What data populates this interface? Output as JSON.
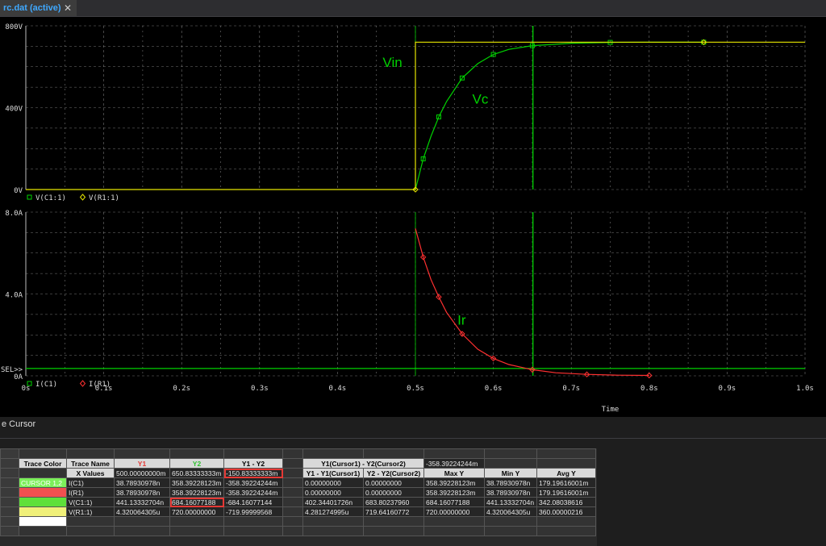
{
  "tab": {
    "title": "rc.dat (active)",
    "close": "✕"
  },
  "colors": {
    "green": "#00d200",
    "yellow": "#e6e600",
    "red": "#ff3030",
    "grid": "#9a9a9a",
    "background": "#000000"
  },
  "chart_data": [
    {
      "type": "line",
      "ylim": [
        0,
        800
      ],
      "xlim": [
        0,
        1.0
      ],
      "yticks": [
        "0V",
        "400V",
        "800V"
      ],
      "annotations": [
        "Vin",
        "Vc"
      ],
      "legend": [
        "V(C1:1)",
        "V(R1:1)"
      ],
      "series": [
        {
          "name": "V(C1:1)",
          "color": "#00d200",
          "x": [
            0.5,
            0.51,
            0.52,
            0.53,
            0.54,
            0.56,
            0.58,
            0.6,
            0.62,
            0.65,
            0.7,
            0.75,
            0.8,
            0.87
          ],
          "y": [
            0,
            150,
            260,
            355,
            430,
            545,
            615,
            660,
            685,
            703,
            715,
            719,
            720,
            720
          ]
        },
        {
          "name": "V(R1:1)",
          "color": "#e6e600",
          "x": [
            0,
            0.5,
            0.5,
            0.87,
            1.0
          ],
          "y": [
            0,
            0,
            720,
            720,
            720
          ]
        }
      ],
      "cursors_x": [
        0.5,
        0.6508
      ]
    },
    {
      "type": "line",
      "ylim": [
        0,
        8
      ],
      "xlim": [
        0,
        1.0
      ],
      "yticks": [
        "0A",
        "4.0A",
        "8.0A"
      ],
      "y_marker_label": "SEL>>",
      "xticks": [
        "0s",
        "0.1s",
        "0.2s",
        "0.3s",
        "0.4s",
        "0.5s",
        "0.6s",
        "0.7s",
        "0.8s",
        "0.9s",
        "1.0s"
      ],
      "xlabel": "Time",
      "annotations": [
        "Ir"
      ],
      "legend": [
        "I(C1)",
        "I(R1)"
      ],
      "series": [
        {
          "name": "I(R1)",
          "color": "#ff3030",
          "x": [
            0.5,
            0.51,
            0.52,
            0.53,
            0.54,
            0.56,
            0.58,
            0.6,
            0.62,
            0.65,
            0.68,
            0.72,
            0.76,
            0.8
          ],
          "y": [
            7.2,
            5.8,
            4.7,
            3.85,
            3.1,
            2.05,
            1.3,
            0.85,
            0.55,
            0.3,
            0.15,
            0.07,
            0.03,
            0.02
          ]
        }
      ],
      "cursors_x": [
        0.5,
        0.6508
      ],
      "cursor_y": 0.359
    }
  ],
  "probe": {
    "title": "e Cursor",
    "top_value": "-358.39224244m",
    "headers": [
      "Trace Color",
      "Trace Name",
      "Y1",
      "Y2",
      "Y1 - Y2",
      "Y1(Cursor1) - Y2(Cursor2)"
    ],
    "x_row": {
      "label": "X Values",
      "y1": "500.00000000m",
      "y2": "650.83333333m",
      "diff": "-150.83333333m",
      "c1": "Y1 - Y1(Cursor1)",
      "c2": "Y2 - Y2(Cursor2)",
      "max": "Max Y",
      "min": "Min Y",
      "avg": "Avg Y"
    },
    "rows": [
      {
        "color_label": "CURSOR 1,2",
        "name": "I(C1)",
        "y1": "38.78930978n",
        "y2": "358.39228123m",
        "diff": "-358.39224244m",
        "c1": "0.00000000",
        "c2": "0.00000000",
        "max": "358.39228123m",
        "min": "38.78930978n",
        "avg": "179.19616001m"
      },
      {
        "color_label": "",
        "name": "I(R1)",
        "y1": "38.78930978n",
        "y2": "358.39228123m",
        "diff": "-358.39224244m",
        "c1": "0.00000000",
        "c2": "0.00000000",
        "max": "358.39228123m",
        "min": "38.78930978n",
        "avg": "179.19616001m"
      },
      {
        "color_label": "",
        "name": "V(C1:1)",
        "y1": "441.13332704n",
        "y2": "684.16077188",
        "diff": "-684.16077144",
        "c1": "402.34401726n",
        "c2": "683.80237960",
        "max": "684.16077188",
        "min": "441.13332704n",
        "avg": "342.08038616"
      },
      {
        "color_label": "",
        "name": "V(R1:1)",
        "y1": "4.320064305u",
        "y2": "720.00000000",
        "diff": "-719.99999568",
        "c1": "4.281274995u",
        "c2": "719.64160772",
        "max": "720.00000000",
        "min": "4.320064305u",
        "avg": "360.00000216"
      }
    ]
  }
}
